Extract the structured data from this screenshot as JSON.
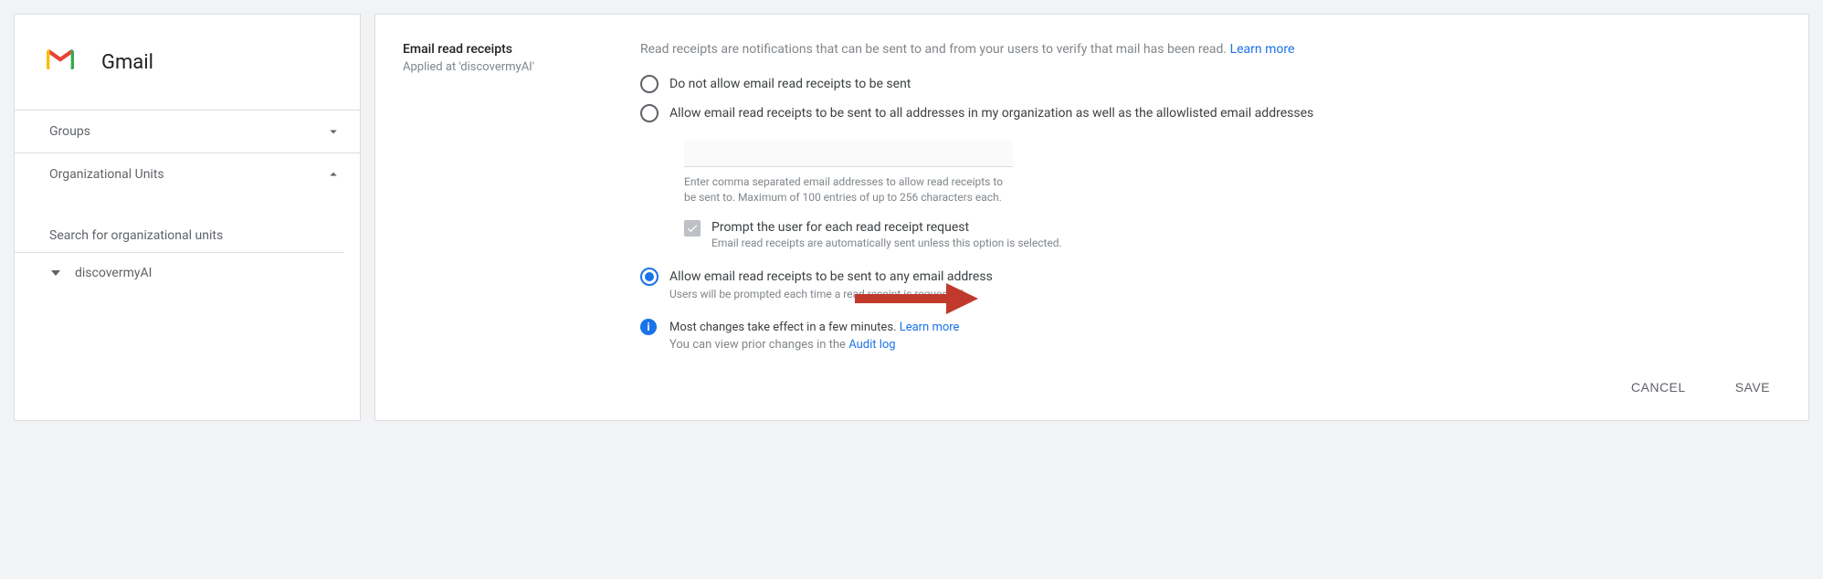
{
  "sidebar": {
    "title": "Gmail",
    "sections": {
      "groups": "Groups",
      "org_units": "Organizational Units"
    },
    "search_placeholder": "Search for organizational units",
    "org_tree": {
      "root": "discovermyAI"
    }
  },
  "settings": {
    "title": "Email read receipts",
    "applied_at": "Applied at 'discovermyAI'",
    "description": "Read receipts are notifications that can be sent to and from your users to verify that mail has been read.",
    "learn_more": "Learn more",
    "options": {
      "opt1": "Do not allow email read receipts to be sent",
      "opt2": "Allow email read receipts to be sent to all addresses in my organization as well as the allowlisted email addresses",
      "opt3": "Allow email read receipts to be sent to any email address",
      "opt3_sub": "Users will be prompted each time a read receipt is requested"
    },
    "allowlist": {
      "helper": "Enter comma separated email addresses to allow read receipts to be sent to. Maximum of 100 entries of up to 256 characters each.",
      "prompt_label": "Prompt the user for each read receipt request",
      "prompt_sub": "Email read receipts are automatically sent unless this option is selected."
    },
    "info": {
      "line1_prefix": "Most changes take effect in a few minutes. ",
      "line1_link": "Learn more",
      "line2_prefix": "You can view prior changes in the ",
      "line2_link": "Audit log"
    },
    "buttons": {
      "cancel": "CANCEL",
      "save": "SAVE"
    }
  }
}
